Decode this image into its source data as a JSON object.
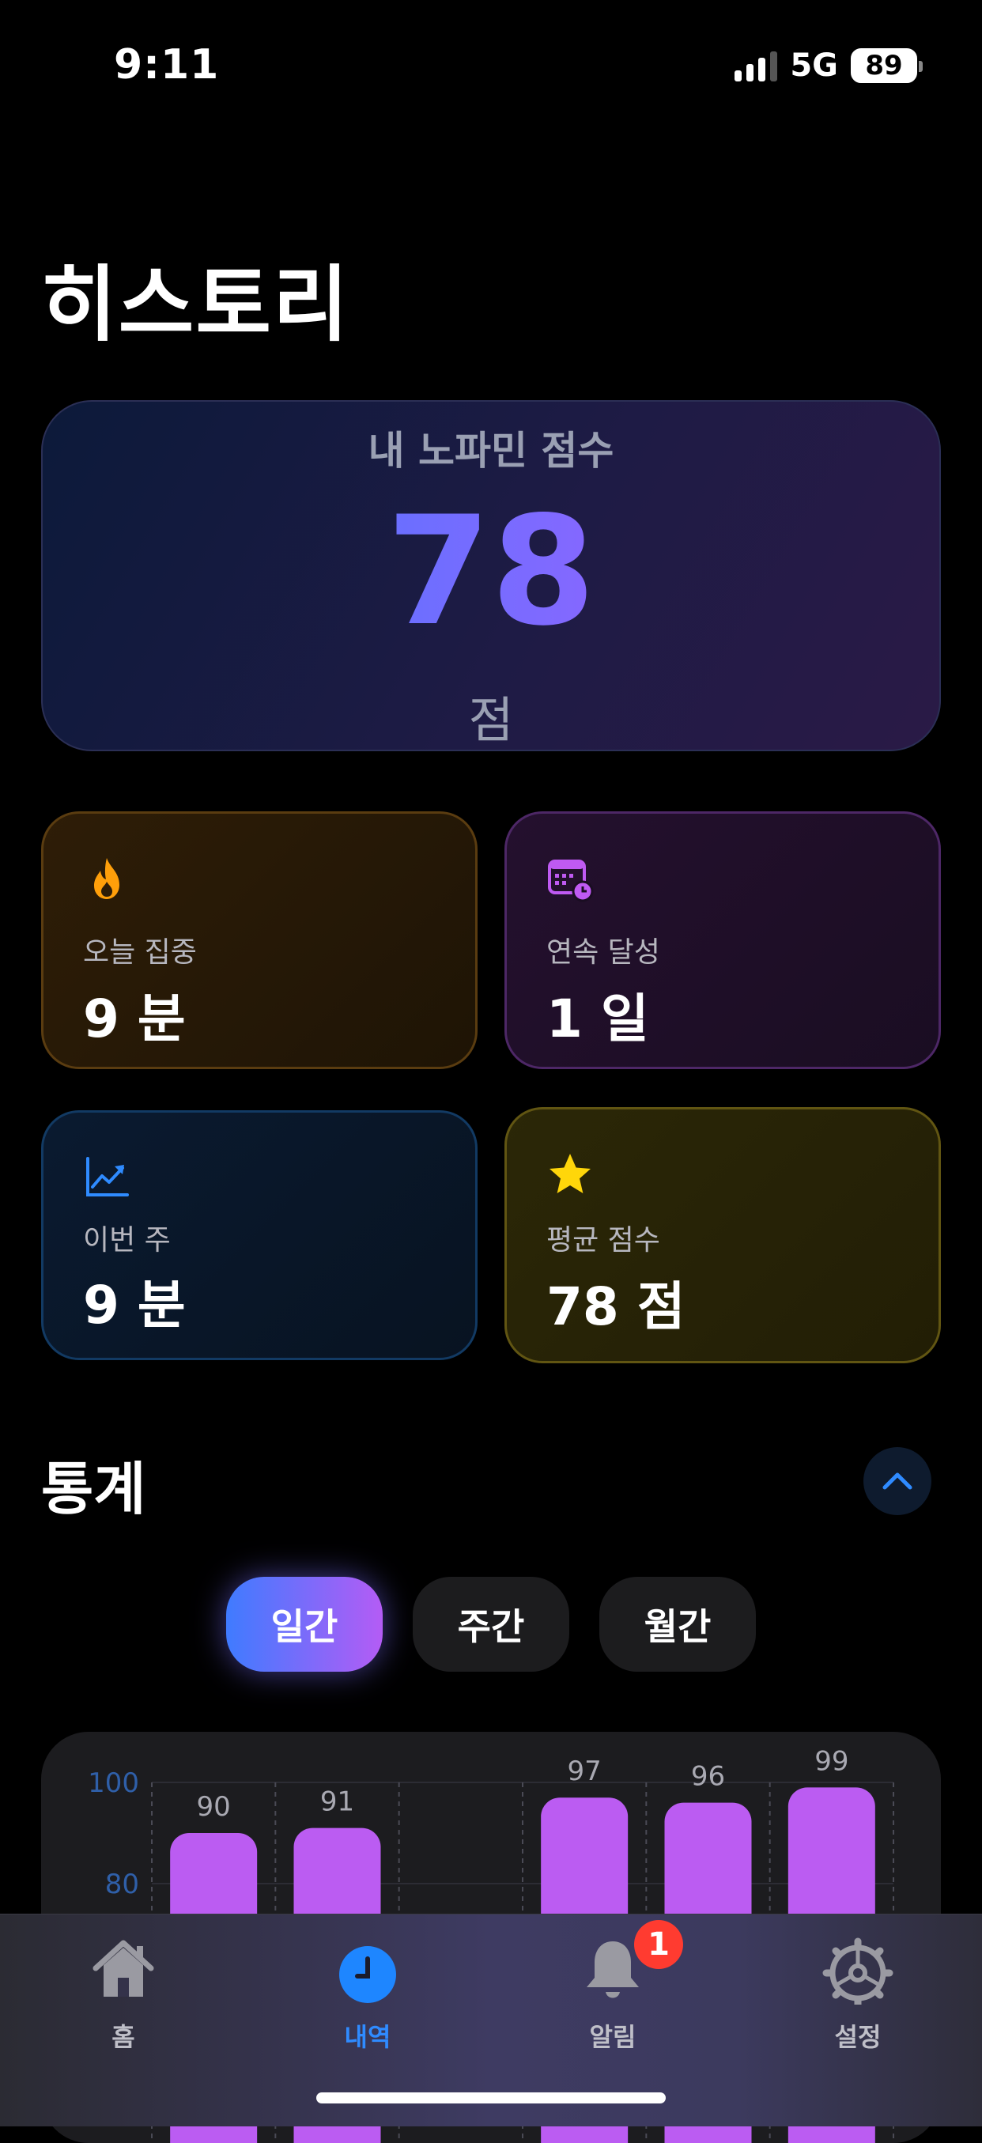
{
  "status": {
    "time": "9:11",
    "network": "5G",
    "battery": "89"
  },
  "page": {
    "title": "히스토리"
  },
  "score_card": {
    "label": "내 노파민 점수",
    "value": "78",
    "unit": "점"
  },
  "stats": {
    "today": {
      "label": "오늘 집중",
      "value": "9 분",
      "icon": "flame-icon"
    },
    "streak": {
      "label": "연속 달성",
      "value": "1 일",
      "icon": "calendar-clock-icon"
    },
    "week": {
      "label": "이번 주",
      "value": "9 분",
      "icon": "chart-trend-icon"
    },
    "average": {
      "label": "평균 점수",
      "value": "78 점",
      "icon": "star-icon"
    }
  },
  "statistics": {
    "title": "통계",
    "tabs": [
      {
        "label": "일간",
        "active": true
      },
      {
        "label": "주간",
        "active": false
      },
      {
        "label": "월간",
        "active": false
      }
    ]
  },
  "chart_data": {
    "type": "bar",
    "y_tick_labels": [
      "100",
      "80"
    ],
    "ylim": [
      70,
      100
    ],
    "slots": 6,
    "bars": [
      {
        "slot": 0,
        "value": 90,
        "label": "90"
      },
      {
        "slot": 1,
        "value": 91,
        "label": "91"
      },
      {
        "slot": 3,
        "value": 97,
        "label": "97"
      },
      {
        "slot": 4,
        "value": 96,
        "label": "96"
      },
      {
        "slot": 5,
        "value": 99,
        "label": "99"
      }
    ],
    "bar_color": "#bb5cf2",
    "tick_color": "#2f5fa8",
    "grid": true
  },
  "tabbar": {
    "items": [
      {
        "label": "홈",
        "icon": "house-icon",
        "active": false
      },
      {
        "label": "내역",
        "icon": "clock-icon",
        "active": true
      },
      {
        "label": "알림",
        "icon": "bell-icon",
        "active": false
      },
      {
        "label": "설정",
        "icon": "gear-icon",
        "active": false
      }
    ],
    "badge": "1"
  }
}
